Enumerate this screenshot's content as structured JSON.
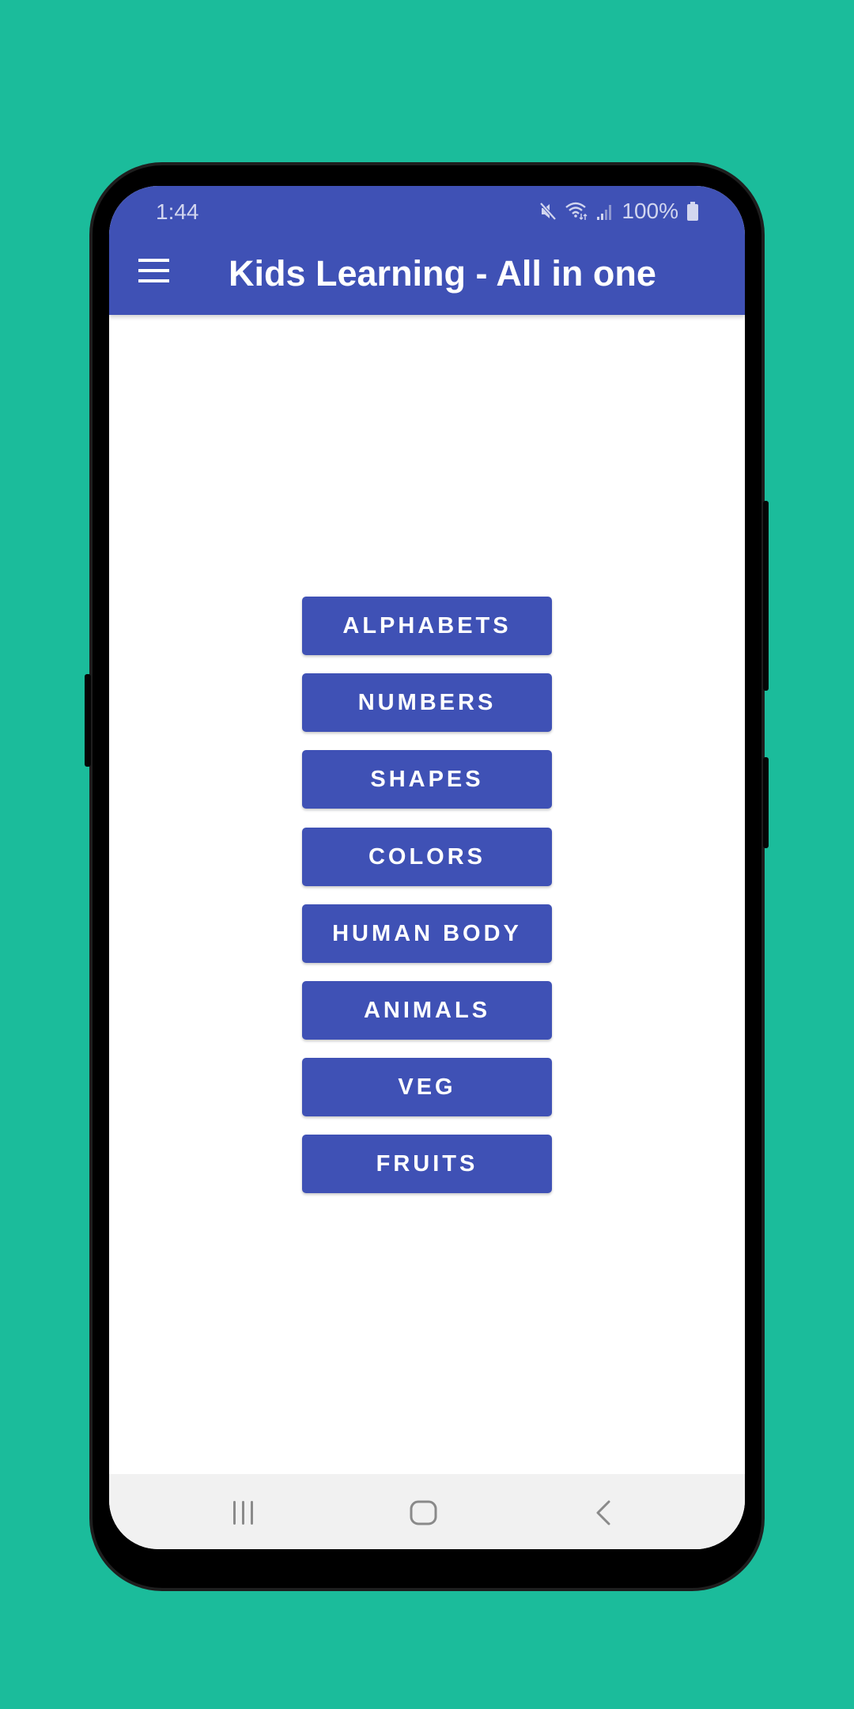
{
  "status_bar": {
    "time": "1:44",
    "battery_percent": "100%",
    "icons": [
      "mute-icon",
      "wifi-icon",
      "signal-icon",
      "battery-icon"
    ]
  },
  "app_bar": {
    "menu_icon": "hamburger-menu-icon",
    "title": "Kids Learning - All in one"
  },
  "menu": {
    "buttons": [
      {
        "label": "ALPHABETS"
      },
      {
        "label": "NUMBERS"
      },
      {
        "label": "SHAPES"
      },
      {
        "label": "COLORS"
      },
      {
        "label": "HUMAN BODY"
      },
      {
        "label": "ANIMALS"
      },
      {
        "label": "VEG"
      },
      {
        "label": "FRUITS"
      }
    ]
  },
  "nav_bar": {
    "icons": [
      "recent-apps-icon",
      "home-icon",
      "back-icon"
    ]
  },
  "colors": {
    "background": "#1BBC9B",
    "primary": "#3F51B5",
    "nav_bar": "#F1F1F1"
  }
}
